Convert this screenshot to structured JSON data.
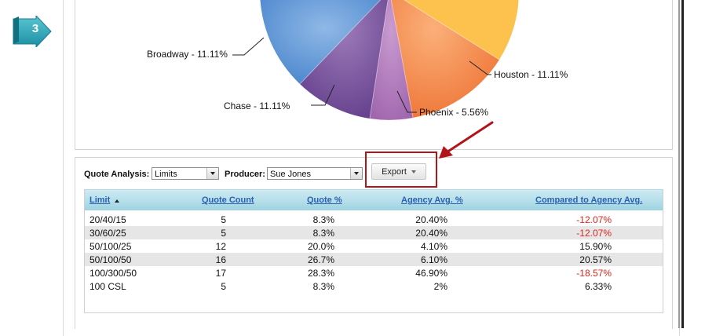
{
  "step_badge": {
    "number": "3",
    "color": "#2aa6b8"
  },
  "pie": {
    "labels": {
      "broadway": "Broadway - 11.11%",
      "chase": "Chase - 11.11%",
      "phoenix": "Phoenix - 5.56%",
      "houston": "Houston - 11.11%"
    }
  },
  "controls": {
    "quote_analysis_label": "Quote Analysis:",
    "quote_analysis_value": "Limits",
    "producer_label": "Producer:",
    "producer_value": "Sue Jones",
    "export_label": "Export"
  },
  "table": {
    "headers": {
      "limit": "Limit",
      "quote_count": "Quote Count",
      "quote_pct": "Quote %",
      "agency_avg": "Agency Avg. %",
      "compared": "Compared to Agency Avg."
    },
    "rows": [
      {
        "limit": "20/40/15",
        "quote_count": "5",
        "quote_pct": "8.3%",
        "agency_avg": "20.40%",
        "compared": "-12.07%",
        "negative": true
      },
      {
        "limit": "30/60/25",
        "quote_count": "5",
        "quote_pct": "8.3%",
        "agency_avg": "20.40%",
        "compared": "-12.07%",
        "negative": true
      },
      {
        "limit": "50/100/25",
        "quote_count": "12",
        "quote_pct": "20.0%",
        "agency_avg": "4.10%",
        "compared": "15.90%",
        "negative": false
      },
      {
        "limit": "50/100/50",
        "quote_count": "16",
        "quote_pct": "26.7%",
        "agency_avg": "6.10%",
        "compared": "20.57%",
        "negative": false
      },
      {
        "limit": "100/300/50",
        "quote_count": "17",
        "quote_pct": "28.3%",
        "agency_avg": "46.90%",
        "compared": "-18.57%",
        "negative": true
      },
      {
        "limit": "100 CSL",
        "quote_count": "5",
        "quote_pct": "8.3%",
        "agency_avg": "2%",
        "compared": "6.33%",
        "negative": false
      }
    ]
  },
  "colors": {
    "negative": "#e2231a",
    "header_link": "#2a61b0",
    "highlight_box": "#b1141b"
  }
}
